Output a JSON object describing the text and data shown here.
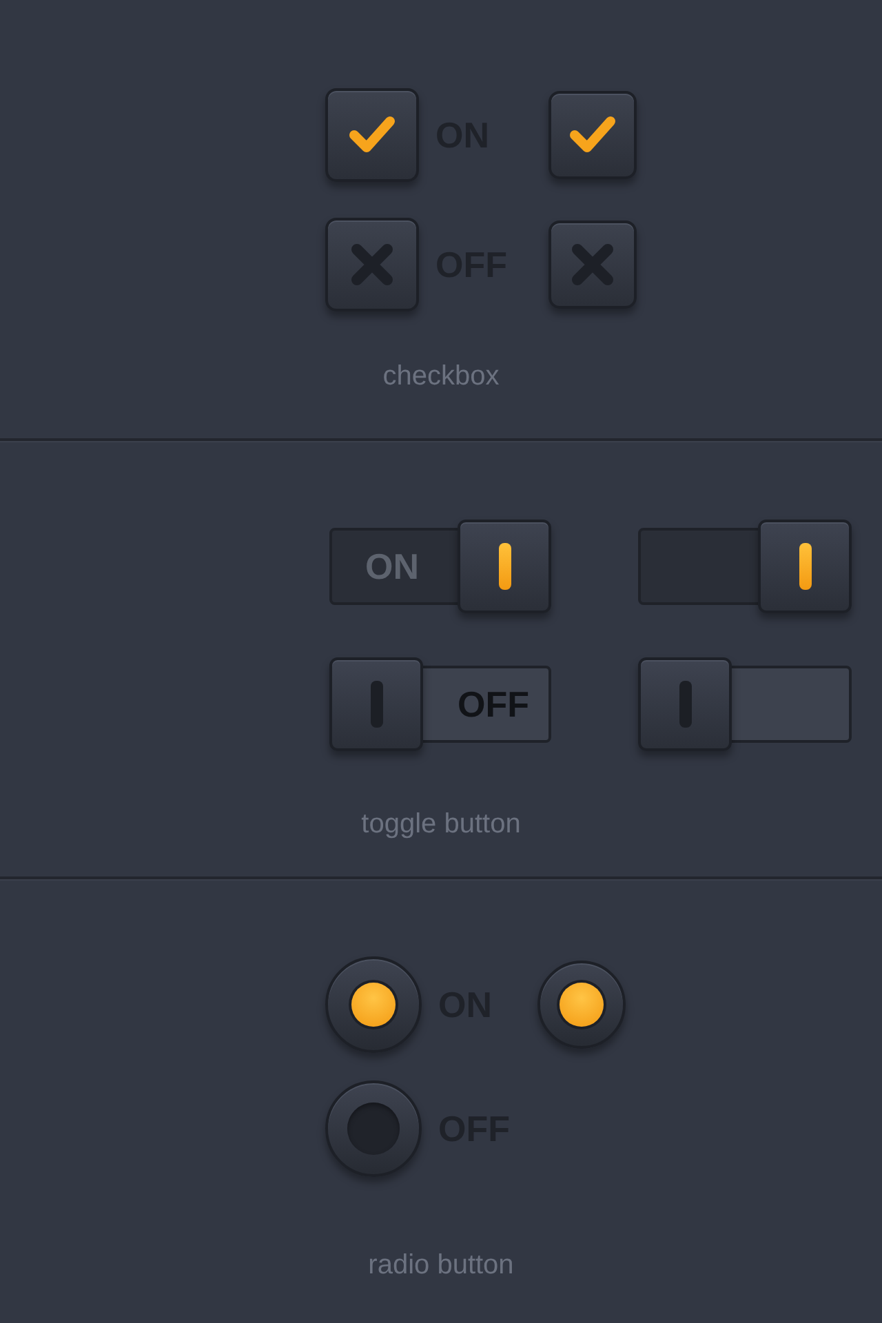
{
  "checkbox_section": {
    "rows": [
      {
        "label": "ON",
        "items": [
          {
            "kind": "large",
            "checked": true
          },
          {
            "kind": "small",
            "checked": true
          }
        ]
      },
      {
        "label": "OFF",
        "items": [
          {
            "kind": "large",
            "checked": false
          },
          {
            "kind": "small",
            "checked": false
          }
        ]
      }
    ],
    "caption": "checkbox"
  },
  "toggle_section": {
    "rows": [
      {
        "toggles": [
          {
            "label": "ON",
            "on": true
          },
          {
            "on": true
          }
        ]
      },
      {
        "toggles": [
          {
            "label": "OFF",
            "on": false
          },
          {
            "on": false
          }
        ]
      }
    ],
    "caption": "toggle button"
  },
  "radio_section": {
    "rows": [
      {
        "label": "ON",
        "items": [
          {
            "kind": "large",
            "selected": true
          },
          {
            "kind": "small",
            "selected": true
          }
        ]
      },
      {
        "label": "OFF",
        "items": [
          {
            "kind": "large",
            "selected": false
          }
        ]
      }
    ],
    "caption": "radio button"
  }
}
